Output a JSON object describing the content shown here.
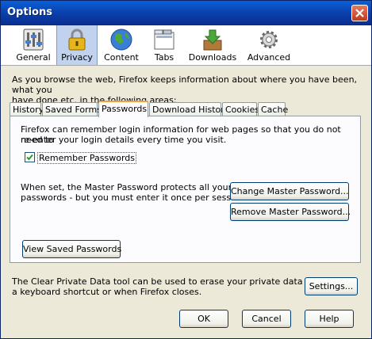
{
  "window": {
    "title": "Options"
  },
  "panes": [
    {
      "label": "General",
      "icon": "general-icon"
    },
    {
      "label": "Privacy",
      "icon": "lock-icon",
      "selected": true
    },
    {
      "label": "Content",
      "icon": "globe-icon"
    },
    {
      "label": "Tabs",
      "icon": "tabs-icon"
    },
    {
      "label": "Downloads",
      "icon": "downloads-icon"
    },
    {
      "label": "Advanced",
      "icon": "gear-icon"
    }
  ],
  "privacy": {
    "description_line1": "As you browse the web, Firefox keeps information about where you have been, what you",
    "description_line2": "have done etc. in the following areas:",
    "tabs": [
      "History",
      "Saved Forms",
      "Passwords",
      "Download History",
      "Cookies",
      "Cache"
    ],
    "selected_tab": "Passwords",
    "passwords": {
      "intro_line1": "Firefox can remember login information for web pages so that you do not need to",
      "intro_line2": "re-enter your login details every time you visit.",
      "remember_label": "Remember Passwords",
      "remember_checked": true,
      "master_line1": "When set, the Master Password protects all your",
      "master_line2": "passwords - but you must enter it once per session.",
      "change_master_button": "Change Master Password...",
      "remove_master_button": "Remove Master Password...",
      "view_saved_button": "View Saved Passwords"
    },
    "clear_line1": "The Clear Private Data tool can be used to erase your private data using",
    "clear_line2": "a keyboard shortcut or when Firefox closes.",
    "settings_button": "Settings..."
  },
  "dialog_buttons": {
    "ok": "OK",
    "cancel": "Cancel",
    "help": "Help"
  }
}
